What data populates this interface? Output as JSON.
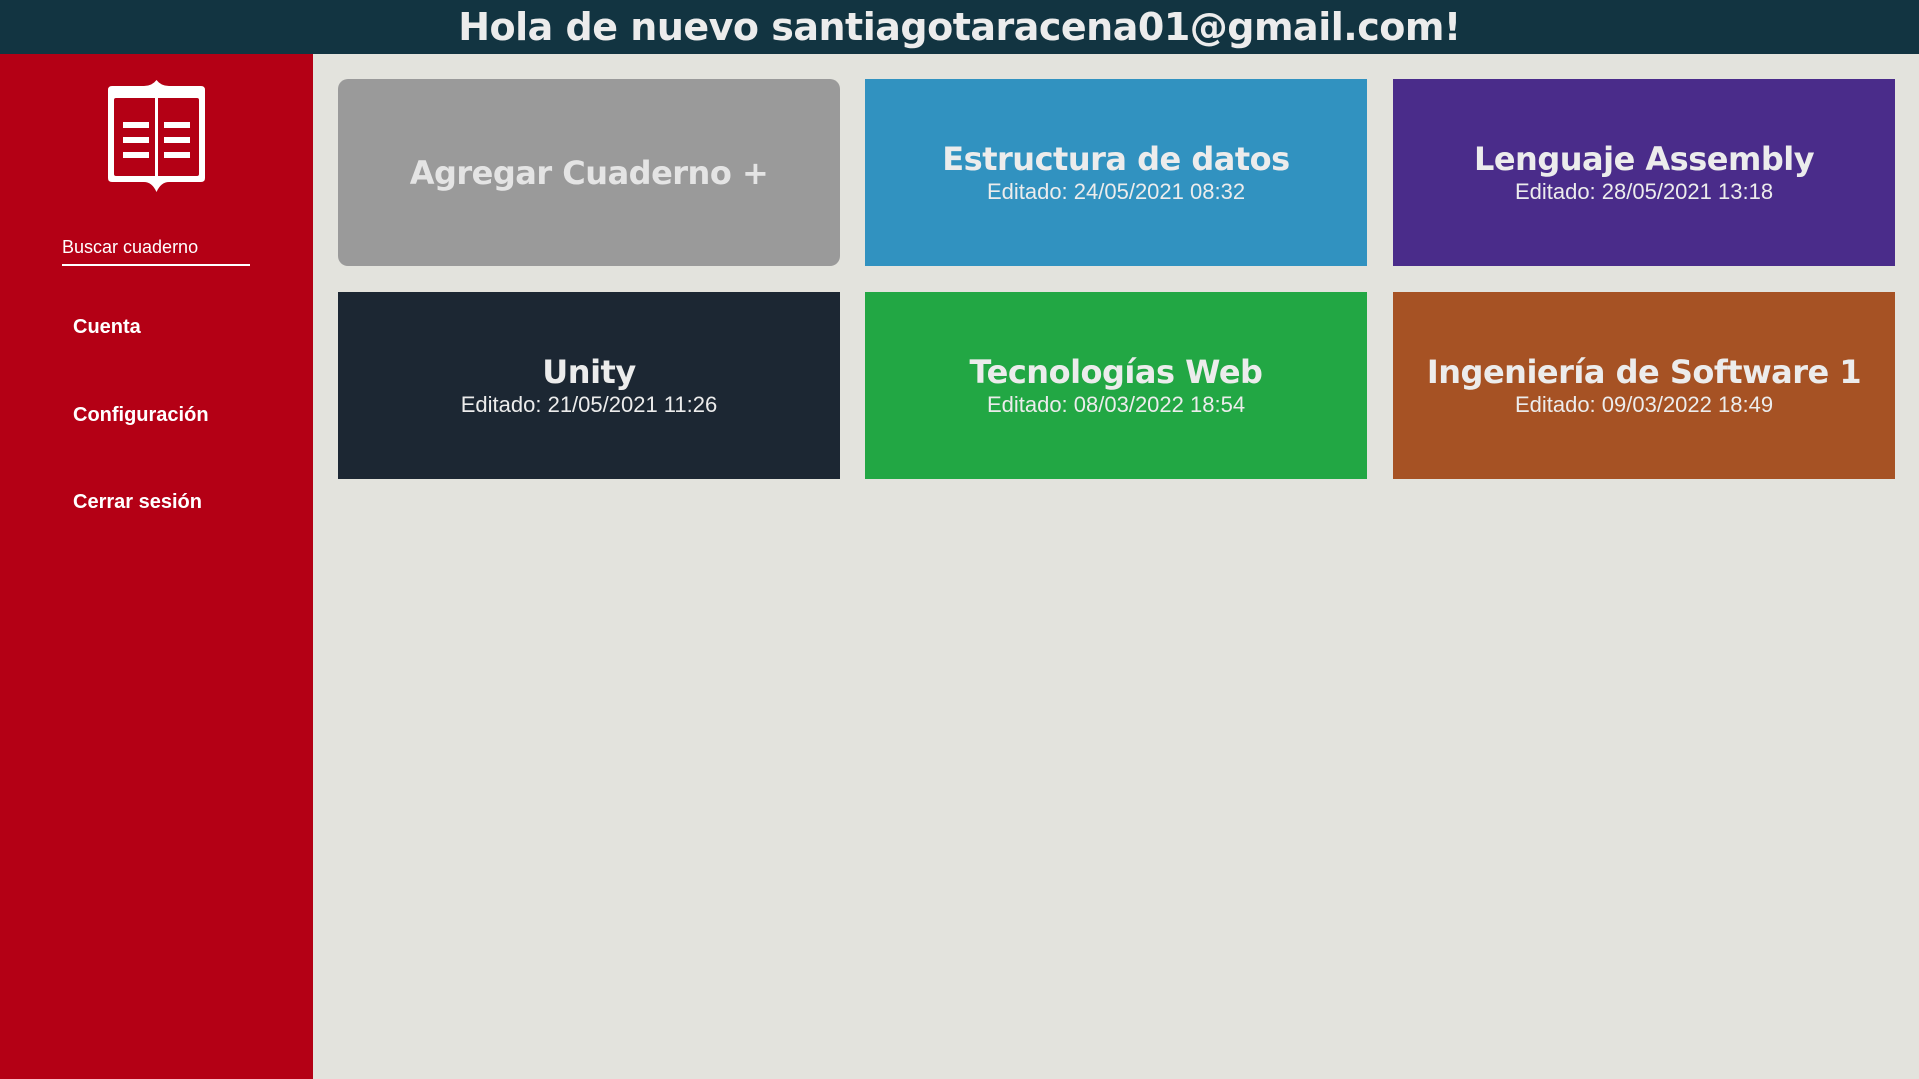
{
  "header": {
    "greeting": "Hola de nuevo santiagotaracena01@gmail.com!"
  },
  "sidebar": {
    "logo_icon": "notebook-icon",
    "search_placeholder": "Buscar cuaderno",
    "items": [
      {
        "label": "Cuenta"
      },
      {
        "label": "Configuración"
      },
      {
        "label": "Cerrar sesión"
      }
    ]
  },
  "colors": {
    "header_bg": "#123441",
    "sidebar_bg": "#b40015",
    "page_bg": "#e3e3dd"
  },
  "add_card": {
    "label": "Agregar Cuaderno +",
    "color": "#9a9a9a"
  },
  "notebooks": [
    {
      "title": "Estructura de datos",
      "edited": "Editado: 24/05/2021 08:32",
      "color": "#3192c0"
    },
    {
      "title": "Lenguaje Assembly",
      "edited": "Editado: 28/05/2021 13:18",
      "color": "#4a2c8a"
    },
    {
      "title": "Unity",
      "edited": "Editado: 21/05/2021 11:26",
      "color": "#1c2733"
    },
    {
      "title": "Tecnologías Web",
      "edited": "Editado: 08/03/2022 18:54",
      "color": "#22a744"
    },
    {
      "title": "Ingeniería de Software 1",
      "edited": "Editado: 09/03/2022 18:49",
      "color": "#a65224"
    }
  ]
}
